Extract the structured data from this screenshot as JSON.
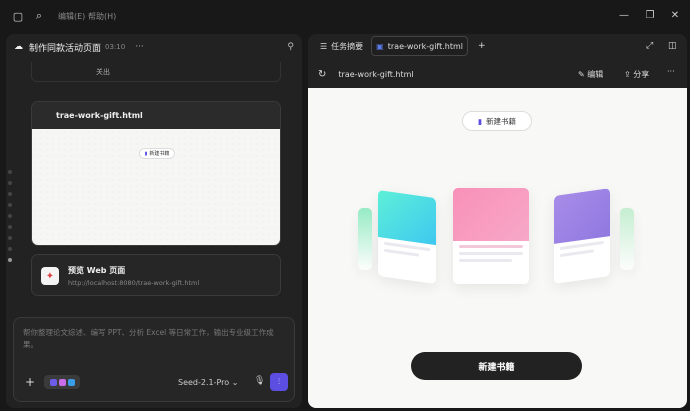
{
  "titlebar": {
    "menu": [
      "编辑(E)",
      "帮助(H)"
    ]
  },
  "left": {
    "title": "制作同款活动页面",
    "time": "03:10",
    "prev_label": "关出",
    "file_card": {
      "title": "trae-work-gift.html",
      "mini_btn": "新建书籍"
    },
    "web_card": {
      "title": "预览 Web 页面",
      "url": "http://localhost:8080/trae-work-gift.html"
    },
    "input": {
      "placeholder": "帮你整理论文综述、编写 PPT、分析 Excel 等日常工作，输出专业级工作成果。",
      "model": "Seed-2.1-Pro"
    }
  },
  "right": {
    "tab_summary": "任务摘要",
    "tab_file": "trae-work-gift.html",
    "toolbar_file": "trae-work-gift.html",
    "edit": "编辑",
    "share": "分享",
    "new_btn": "新建书籍",
    "big_btn": "新建书籍"
  },
  "colors": {
    "accent": "#5b4ee0",
    "book_blue": "#3ee0e8",
    "book_pink": "#f48ab8",
    "book_purple": "#9a7be6"
  }
}
